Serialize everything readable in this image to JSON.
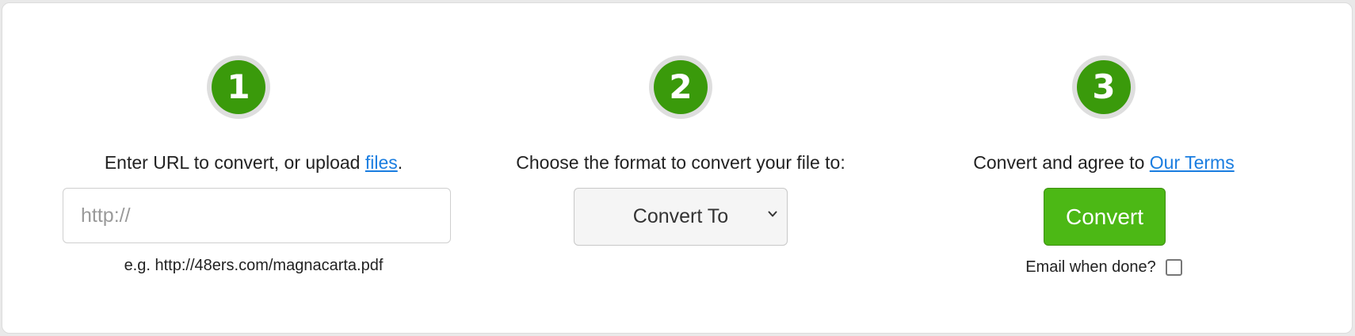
{
  "steps": [
    {
      "number": "1",
      "text_before": "Enter URL to convert, or upload ",
      "link": "files",
      "text_after": "."
    },
    {
      "number": "2",
      "text": "Choose the format to convert your file to:"
    },
    {
      "number": "3",
      "text_before": "Convert and agree to ",
      "link": "Our Terms"
    }
  ],
  "url_input": {
    "placeholder": "http://",
    "value": ""
  },
  "example_text": "e.g. http://48ers.com/magnacarta.pdf",
  "convert_to_select": {
    "selected": "Convert To"
  },
  "convert_button": {
    "label": "Convert"
  },
  "email_option": {
    "label": "Email when done?",
    "checked": false
  },
  "colors": {
    "step_badge_green": "#3a9a0b",
    "step_badge_ring": "#dedede",
    "convert_button_green": "#4cb815",
    "link_blue": "#1a7de0"
  },
  "icons": {
    "select_arrow": "chevron-down-icon"
  }
}
